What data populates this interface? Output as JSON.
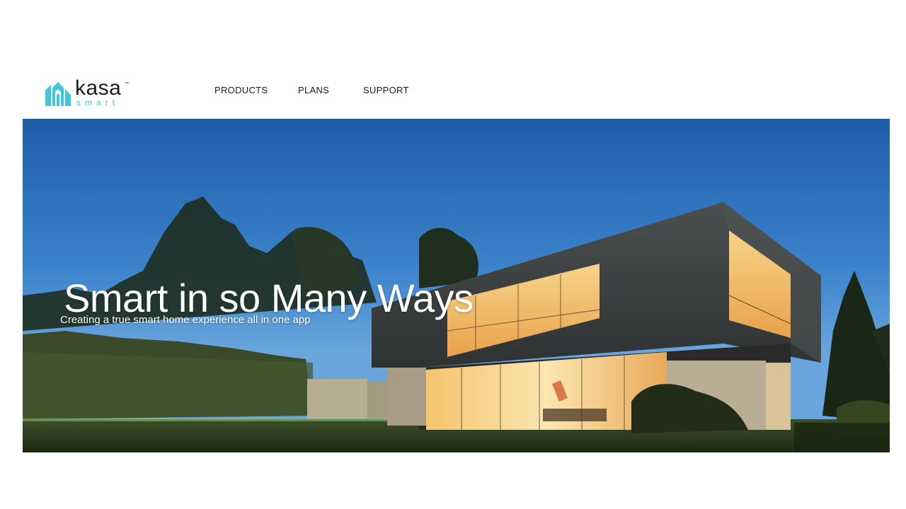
{
  "brand": {
    "name": "kasa",
    "trademark": "™",
    "tagline": "smart",
    "logo_color": "#3fc6d8"
  },
  "nav": {
    "items": [
      {
        "label": "PRODUCTS"
      },
      {
        "label": "PLANS"
      },
      {
        "label": "SUPPORT"
      }
    ]
  },
  "hero": {
    "title": "Smart in so Many Ways",
    "subtitle": "Creating a true smart home experience all in one app",
    "image_description_icon": "modern-house-photo"
  }
}
